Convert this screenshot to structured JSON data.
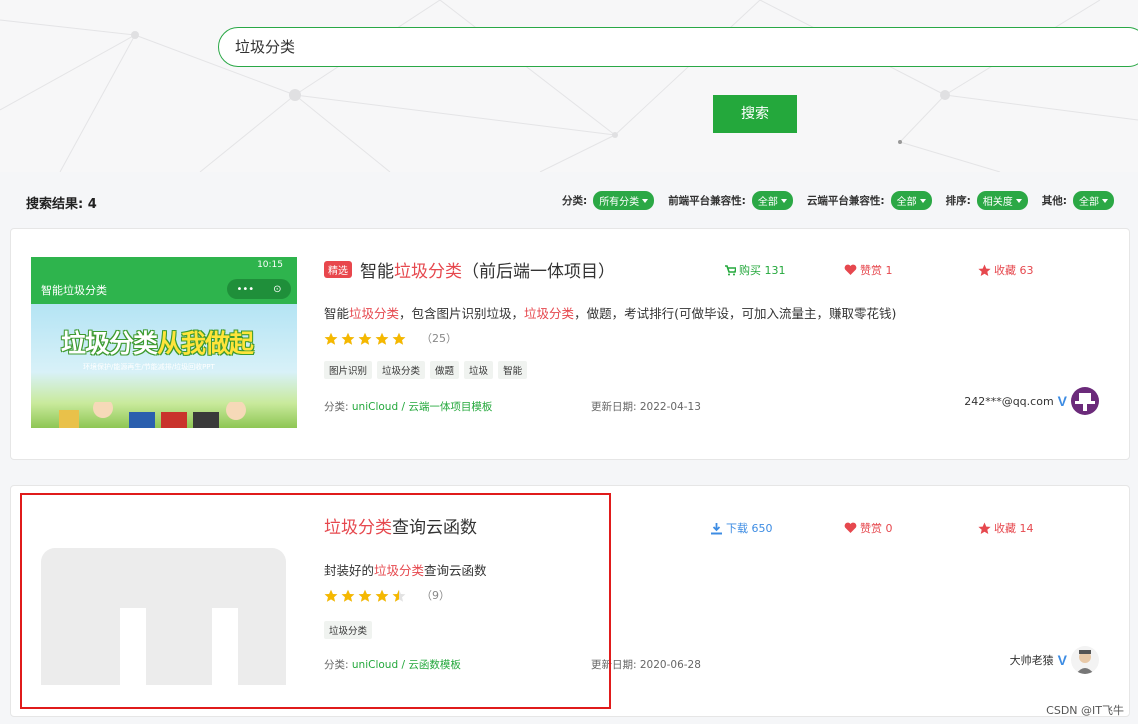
{
  "search": {
    "value": "垃圾分类",
    "button_label": "搜索"
  },
  "results": {
    "label": "搜索结果: 4",
    "filters": [
      {
        "label": "分类:",
        "value": "所有分类"
      },
      {
        "label": "前端平台兼容性:",
        "value": "全部"
      },
      {
        "label": "云端平台兼容性:",
        "value": "全部"
      },
      {
        "label": "排序:",
        "value": "相关度"
      },
      {
        "label": "其他:",
        "value": "全部"
      }
    ]
  },
  "items": [
    {
      "badge": "精选",
      "title_pre": "智能",
      "title_hl": "垃圾分类",
      "title_post": "（前后端一体项目）",
      "stat1": "购买 131",
      "stat2": "赞赏 1",
      "stat3": "收藏 63",
      "desc_pre": "智能",
      "desc_hl1": "垃圾分类",
      "desc_mid": "，包含图片识别垃圾，",
      "desc_hl2": "垃圾分类",
      "desc_post": "，做题，考试排行(可做毕设，可加入流量主，赚取零花钱)",
      "rating": 5,
      "rating_count": "（25）",
      "tags": [
        "图片识别",
        "垃圾分类",
        "做题",
        "垃圾",
        "智能"
      ],
      "category_label": "分类:",
      "category_link": "uniCloud / 云端一体项目模板",
      "update_label": "更新日期: 2022-04-13",
      "author": "242***@qq.com",
      "thumb": {
        "status_text": "10:15",
        "app_title": "智能垃圾分类",
        "capsule_dots": "•••",
        "capsule_circle": "⊙",
        "banner_white": "垃圾分类",
        "banner_yellow": "从我做起",
        "banner_sub": "环境保护/能源再生/节能减排/垃圾回收PPT"
      }
    },
    {
      "title_hl": "垃圾分类",
      "title_post": "查询云函数",
      "stat1": "下载 650",
      "stat2": "赞赏 0",
      "stat3": "收藏 14",
      "desc_pre": "封装好的",
      "desc_hl1": "垃圾分类",
      "desc_post": "查询云函数",
      "rating": 4.5,
      "rating_count": "（9）",
      "tags": [
        "垃圾分类"
      ],
      "category_label": "分类:",
      "category_link": "uniCloud / 云函数模板",
      "update_label": "更新日期: 2020-06-28",
      "author": "大帅老猿"
    }
  ],
  "verified_mark": "V",
  "watermark": "CSDN @IT飞牛",
  "colors": {
    "accent": "#24a83c",
    "highlight": "#e6484e",
    "link_blue": "#3d8ce3",
    "box_red": "#e01b1b"
  }
}
